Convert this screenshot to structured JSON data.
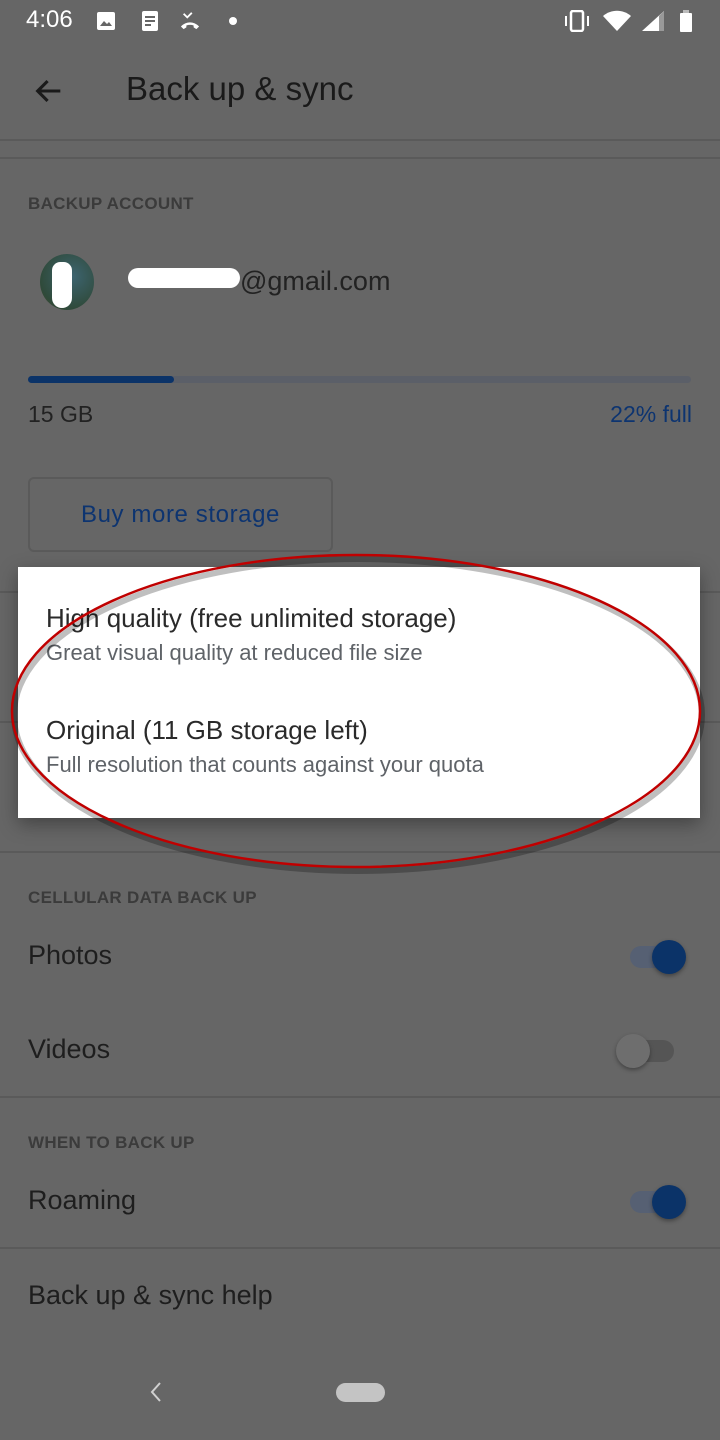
{
  "status_bar": {
    "time": "4:06",
    "left_icons": [
      "image-icon",
      "document-icon",
      "missed-call-icon",
      "dot-icon"
    ],
    "right_icons": [
      "vibrate-icon",
      "wifi-icon",
      "signal-icon",
      "battery-icon"
    ]
  },
  "app_bar": {
    "title": "Back up & sync",
    "back_icon": "arrow-back-icon"
  },
  "backup_account": {
    "header": "BACKUP ACCOUNT",
    "email": "@gmail.com",
    "storage_total": "15 GB",
    "storage_percent_label": "22% full",
    "storage_fraction": 0.22,
    "buy_button": "Buy more storage"
  },
  "upload_size_dialog": {
    "options": [
      {
        "title": "High quality (free unlimited storage)",
        "subtitle": "Great visual quality at reduced file size"
      },
      {
        "title": "Original (11 GB storage left)",
        "subtitle": "Full resolution that counts against your quota"
      }
    ]
  },
  "cellular": {
    "header": "CELLULAR DATA BACK UP",
    "items": [
      {
        "label": "Photos",
        "on": true
      },
      {
        "label": "Videos",
        "on": false
      }
    ]
  },
  "when_to_back_up": {
    "header": "WHEN TO BACK UP",
    "items": [
      {
        "label": "Roaming",
        "on": true
      }
    ]
  },
  "help": {
    "label": "Back up & sync help"
  },
  "colors": {
    "accent": "#0b3368",
    "scrim": "#666666",
    "annotation": "#c00000"
  }
}
